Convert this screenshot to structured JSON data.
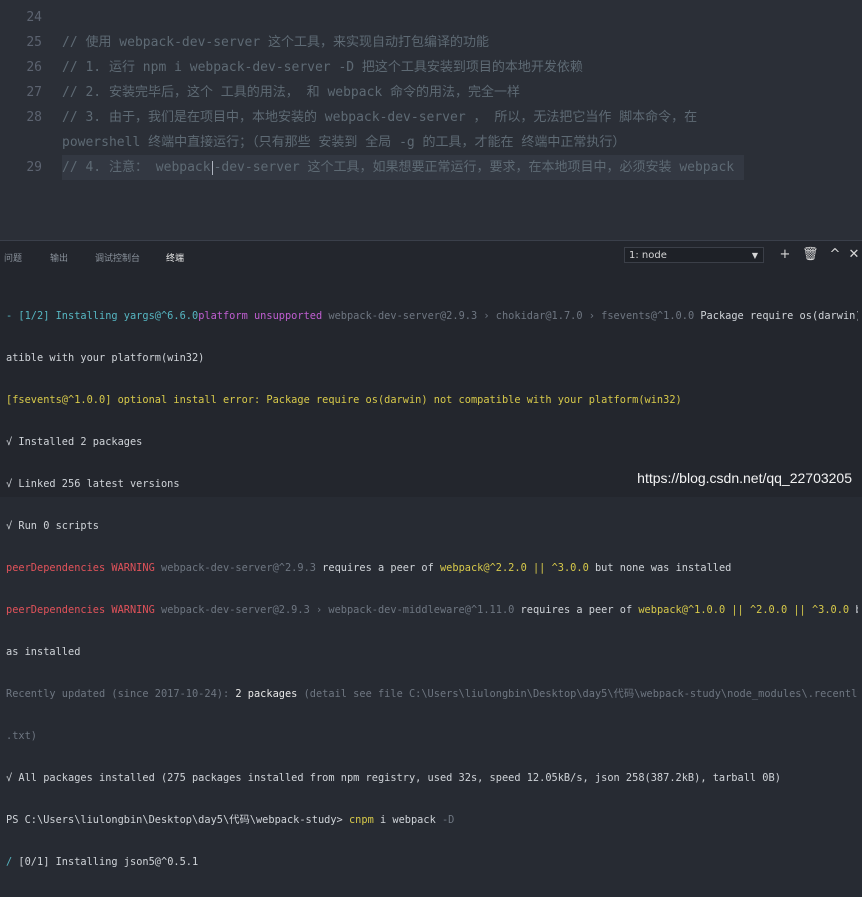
{
  "editor": {
    "lines": [
      {
        "num": "24",
        "text": ""
      },
      {
        "num": "25",
        "text": "// 使用 webpack-dev-server 这个工具，来实现自动打包编译的功能"
      },
      {
        "num": "26",
        "text": "// 1. 运行 npm i webpack-dev-server -D 把这个工具安装到项目的本地开发依赖"
      },
      {
        "num": "27",
        "text": "// 2. 安装完毕后，这个 工具的用法， 和 webpack 命令的用法，完全一样"
      },
      {
        "num": "28",
        "text": "// 3. 由于，我们是在项目中，本地安装的 webpack-dev-server ， 所以，无法把它当作 脚本命令，在"
      },
      {
        "num": "",
        "text": "powershell 终端中直接运行；（只有那些 安装到 全局 -g 的工具，才能在 终端中正常执行）"
      },
      {
        "num": "29",
        "text_a": "// 4. 注意： webpack",
        "text_b": "-dev-server 这个工具，如果想要正常运行，要求，在本地项目中，必须安装 webpack"
      }
    ]
  },
  "panel": {
    "tabs": [
      "问题",
      "输出",
      "调试控制台",
      "终端"
    ],
    "terminal_select": "1: node",
    "icons": [
      "plus-icon",
      "trash-icon",
      "chevron-up-icon",
      "close-icon"
    ]
  },
  "terminal": {
    "l1": {
      "a": "- [1/2] Installing yargs@^6.6.0",
      "b": "platform unsupported",
      "c": " webpack-dev-server@2.9.3 › chokidar@1.7.0 › fsevents@^1.0.0",
      "d": " Package require os(darwin) not comp"
    },
    "l2": "atible with your platform(win32)",
    "l3": "[fsevents@^1.0.0] optional install error: Package require os(darwin) not compatible with your platform(win32)",
    "l4": "√ Installed 2 packages",
    "l5": "√ Linked 256 latest versions",
    "l6": "√ Run 0 scripts",
    "l7": {
      "a": "peerDependencies WARNING",
      "b": " webpack-dev-server@^2.9.3",
      "c": " requires a peer of ",
      "d": "webpack@^2.2.0 || ^3.0.0",
      "e": " but none was installed"
    },
    "l8": {
      "a": "peerDependencies WARNING",
      "b": " webpack-dev-server@2.9.3 › webpack-dev-middleware@^1.11.0",
      "c": " requires a peer of ",
      "d": "webpack@^1.0.0 || ^2.0.0 || ^3.0.0",
      "e": " but none w"
    },
    "l9": "as installed",
    "l10": {
      "a": "Recently updated (since 2017-10-24): ",
      "b": "2 packages",
      "c": " (detail see file C:\\Users\\liulongbin\\Desktop\\day5\\代码\\webpack-study\\node_modules\\.recently_updates"
    },
    "l11": ".txt)",
    "l12": "√ All packages installed (275 packages installed from npm registry, used 32s, speed 12.05kB/s, json 258(387.2kB), tarball 0B)",
    "l13": {
      "a": "PS C:\\Users\\liulongbin\\Desktop\\day5\\代码\\webpack-study> ",
      "b": "cnpm",
      "c": " i webpack ",
      "d": "-D"
    },
    "l14": {
      "a": "/ ",
      "b": "[0/1] Installing json5@^0.5.1"
    }
  },
  "watermark": "https://blog.csdn.net/qq_22703205"
}
